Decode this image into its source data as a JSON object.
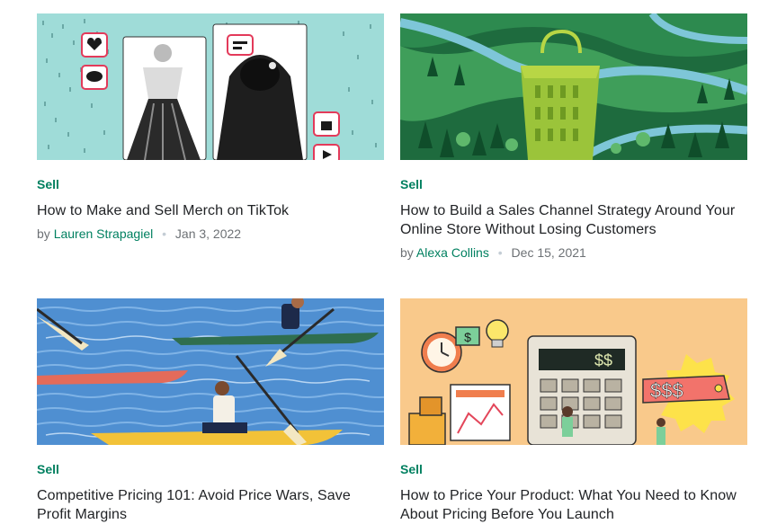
{
  "cards": [
    {
      "category": "Sell",
      "title": "How to Make and Sell Merch on TikTok",
      "by": "by",
      "author": "Lauren Strapagiel",
      "date": "Jan 3, 2022",
      "image_icon": "tiktok-merch-illustration"
    },
    {
      "category": "Sell",
      "title": "How to Build a Sales Channel Strategy Around Your Online Store Without Losing Customers",
      "by": "by",
      "author": "Alexa Collins",
      "date": "Dec 15, 2021",
      "image_icon": "shopping-bag-landscape-illustration"
    },
    {
      "category": "Sell",
      "title": "Competitive Pricing 101: Avoid Price Wars, Save Profit Margins",
      "image_icon": "kayak-race-illustration"
    },
    {
      "category": "Sell",
      "title": "How to Price Your Product: What You Need to Know About Pricing Before You Launch",
      "image_icon": "calculator-price-tag-illustration",
      "illustration_text": {
        "calculator_display": "$$",
        "price_tag": "$$$",
        "sign": "$"
      }
    }
  ],
  "colors": {
    "accent": "#008060",
    "text": "#212326",
    "muted": "#6d7175"
  }
}
